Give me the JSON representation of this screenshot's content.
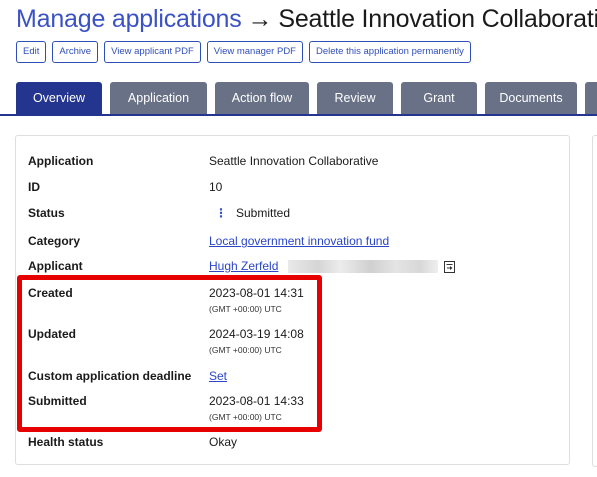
{
  "header": {
    "crumb": "Manage applications",
    "arrow": "→",
    "application_name": "Seattle Innovation Collaborative"
  },
  "actions": [
    "Edit",
    "Archive",
    "View applicant PDF",
    "View manager PDF",
    "Delete this application permanently"
  ],
  "tabs": [
    "Overview",
    "Application",
    "Action flow",
    "Review",
    "Grant",
    "Documents"
  ],
  "active_tab": "Overview",
  "details": {
    "application": {
      "label": "Application",
      "value": "Seattle Innovation Collaborative"
    },
    "id": {
      "label": "ID",
      "value": "10"
    },
    "status": {
      "label": "Status",
      "value": "Submitted",
      "icon": "kebab-dots-icon"
    },
    "category": {
      "label": "Category",
      "value": "Local government innovation fund"
    },
    "applicant": {
      "label": "Applicant",
      "value": "Hugh Zerfeld",
      "icon": "copy-icon"
    },
    "created": {
      "label": "Created",
      "value": "2023-08-01 14:31",
      "tz": "(GMT +00:00) UTC"
    },
    "updated": {
      "label": "Updated",
      "value": "2024-03-19 14:08",
      "tz": "(GMT +00:00) UTC"
    },
    "deadline": {
      "label": "Custom application deadline",
      "value": "Set"
    },
    "submitted": {
      "label": "Submitted",
      "value": "2023-08-01 14:33",
      "tz": "(GMT +00:00) UTC"
    },
    "health": {
      "label": "Health status",
      "value": "Okay"
    }
  },
  "colors": {
    "accent": "#3b52c4",
    "tab_active": "#23358f",
    "tab_inactive": "#697186",
    "highlight": "#e60000"
  }
}
